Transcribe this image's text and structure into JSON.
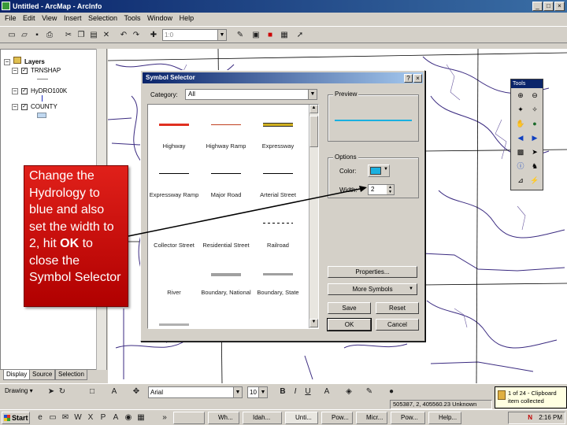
{
  "window": {
    "title": "Untitled - ArcMap - ArcInfo",
    "controls": [
      "_",
      "□",
      "×"
    ]
  },
  "menu": [
    "File",
    "Edit",
    "View",
    "Insert",
    "Selection",
    "Tools",
    "Window",
    "Help"
  ],
  "toolbar": {
    "scale_placeholder": "1:0"
  },
  "toc": {
    "root": "Layers",
    "layers": [
      {
        "name": "TRNSHAP",
        "checked": true
      },
      {
        "name": "HyDRO100K",
        "checked": true
      },
      {
        "name": "COUNTY",
        "checked": true
      }
    ],
    "tabs": [
      "Display",
      "Source",
      "Selection"
    ]
  },
  "dialog": {
    "title": "Symbol Selector",
    "category_label": "Category:",
    "category_value": "All",
    "preview_label": "Preview",
    "options_label": "Options",
    "color_label": "Color:",
    "width_label": "Width:",
    "width_value": "2",
    "symbols": [
      {
        "label": "Highway",
        "color": "#e03020",
        "weight": 3
      },
      {
        "label": "Highway Ramp",
        "color": "#c04020",
        "weight": 1
      },
      {
        "label": "Expressway",
        "color": "#303030",
        "weight": 3,
        "double": true
      },
      {
        "label": "Expressway Ramp",
        "color": "#000000",
        "weight": 1
      },
      {
        "label": "Major Road",
        "color": "#000000",
        "weight": 1
      },
      {
        "label": "Arterial Street",
        "color": "#000000",
        "weight": 1
      },
      {
        "label": "Collector Street",
        "color": "#000000",
        "weight": 1
      },
      {
        "label": "Residential Street",
        "color": "#000000",
        "weight": 1
      },
      {
        "label": "Railroad",
        "color": "#000000",
        "weight": 1,
        "dashed": true
      },
      {
        "label": "River",
        "color": "#000000",
        "weight": 0
      },
      {
        "label": "Boundary, National",
        "color": "#a0a0a0",
        "weight": 4
      },
      {
        "label": "Boundary, State",
        "color": "#a0a0a0",
        "weight": 3
      }
    ],
    "buttons": {
      "properties": "Properties...",
      "more_symbols": "More Symbols",
      "save": "Save",
      "reset": "Reset",
      "ok": "OK",
      "cancel": "Cancel"
    },
    "preview_color": "#1ab0e0"
  },
  "tools_palette": {
    "title": "Tools"
  },
  "callout": {
    "text_before": "Change the Hydrology to blue and also set the width to 2,  hit ",
    "emphasis": "OK",
    "text_after": " to close the Symbol Selector"
  },
  "drawbar": {
    "drawing": "Drawing",
    "font": "Arial",
    "font_size": "10"
  },
  "status": {
    "coords": "505387, 2, 405560.23 Unknown"
  },
  "balloon": {
    "line1": "1 of 24 - Clipboard",
    "line2": "item collected"
  },
  "taskbar": {
    "start": "Start",
    "tasks": [
      "Wh...",
      "Idah...",
      "Unti...",
      "Pow...",
      "Micr...",
      "Pow...",
      "Help..."
    ],
    "clock": "2:16 PM"
  }
}
